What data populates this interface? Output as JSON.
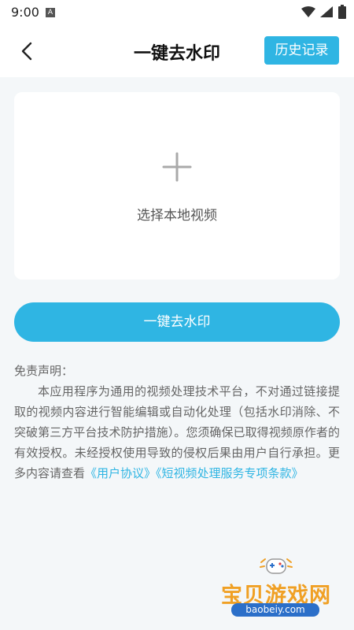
{
  "status_bar": {
    "time": "9:00",
    "notification_icon_letter": "A",
    "icons": [
      "wifi-icon",
      "signal-icon",
      "battery-icon"
    ]
  },
  "header": {
    "back_icon": "chevron-left-icon",
    "title": "一键去水印",
    "history_button": "历史记录"
  },
  "upload": {
    "icon": "plus-icon",
    "label": "选择本地视频"
  },
  "action": {
    "button_label": "一键去水印"
  },
  "disclaimer": {
    "heading": "免责声明：",
    "body": "本应用程序为通用的视频处理技术平台，不对通过链接提取的视频内容进行智能编辑或自动化处理（包括水印消除、不突破第三方平台技术防护措施）。您须确保已取得视频原作者的有效授权。未经授权使用导致的侵权后果由用户自行承担。更多内容请查看",
    "link_user_agreement": "《用户协议》",
    "link_service_terms": "《短视频处理服务专项条款》"
  },
  "watermark": {
    "text": "宝贝游戏网",
    "url": "baobeiy.com"
  },
  "colors": {
    "accent": "#2fb5e3",
    "background": "#f4f7f9",
    "watermark_orange": "#f0a024",
    "watermark_blue": "#2b6fc9"
  }
}
